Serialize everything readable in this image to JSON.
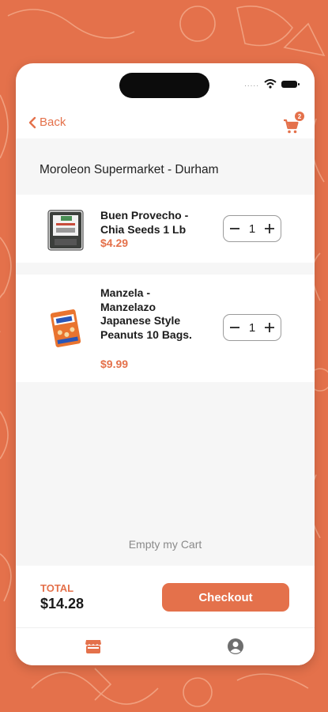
{
  "colors": {
    "accent": "#e4714b",
    "background": "#e4714b",
    "surface": "#ffffff",
    "muted": "#f6f6f6"
  },
  "status_bar": {
    "signal_dots": "....."
  },
  "nav": {
    "back_label": "Back",
    "cart_count": "2"
  },
  "store": {
    "name": "Moroleon Supermarket - Durham"
  },
  "items": [
    {
      "name": "Buen Provecho - Chia Seeds 1 Lb",
      "price": "$4.29",
      "quantity": "1"
    },
    {
      "name": "Manzela - Manzelazo Japanese Style Peanuts 10 Bags.",
      "price": "$9.99",
      "quantity": "1"
    }
  ],
  "cart": {
    "empty_label": "Empty my Cart",
    "total_label": "TOTAL",
    "total_value": "$14.28",
    "checkout_label": "Checkout"
  },
  "tabs": [
    {
      "icon": "store-icon",
      "active": true
    },
    {
      "icon": "profile-icon",
      "active": false
    }
  ]
}
